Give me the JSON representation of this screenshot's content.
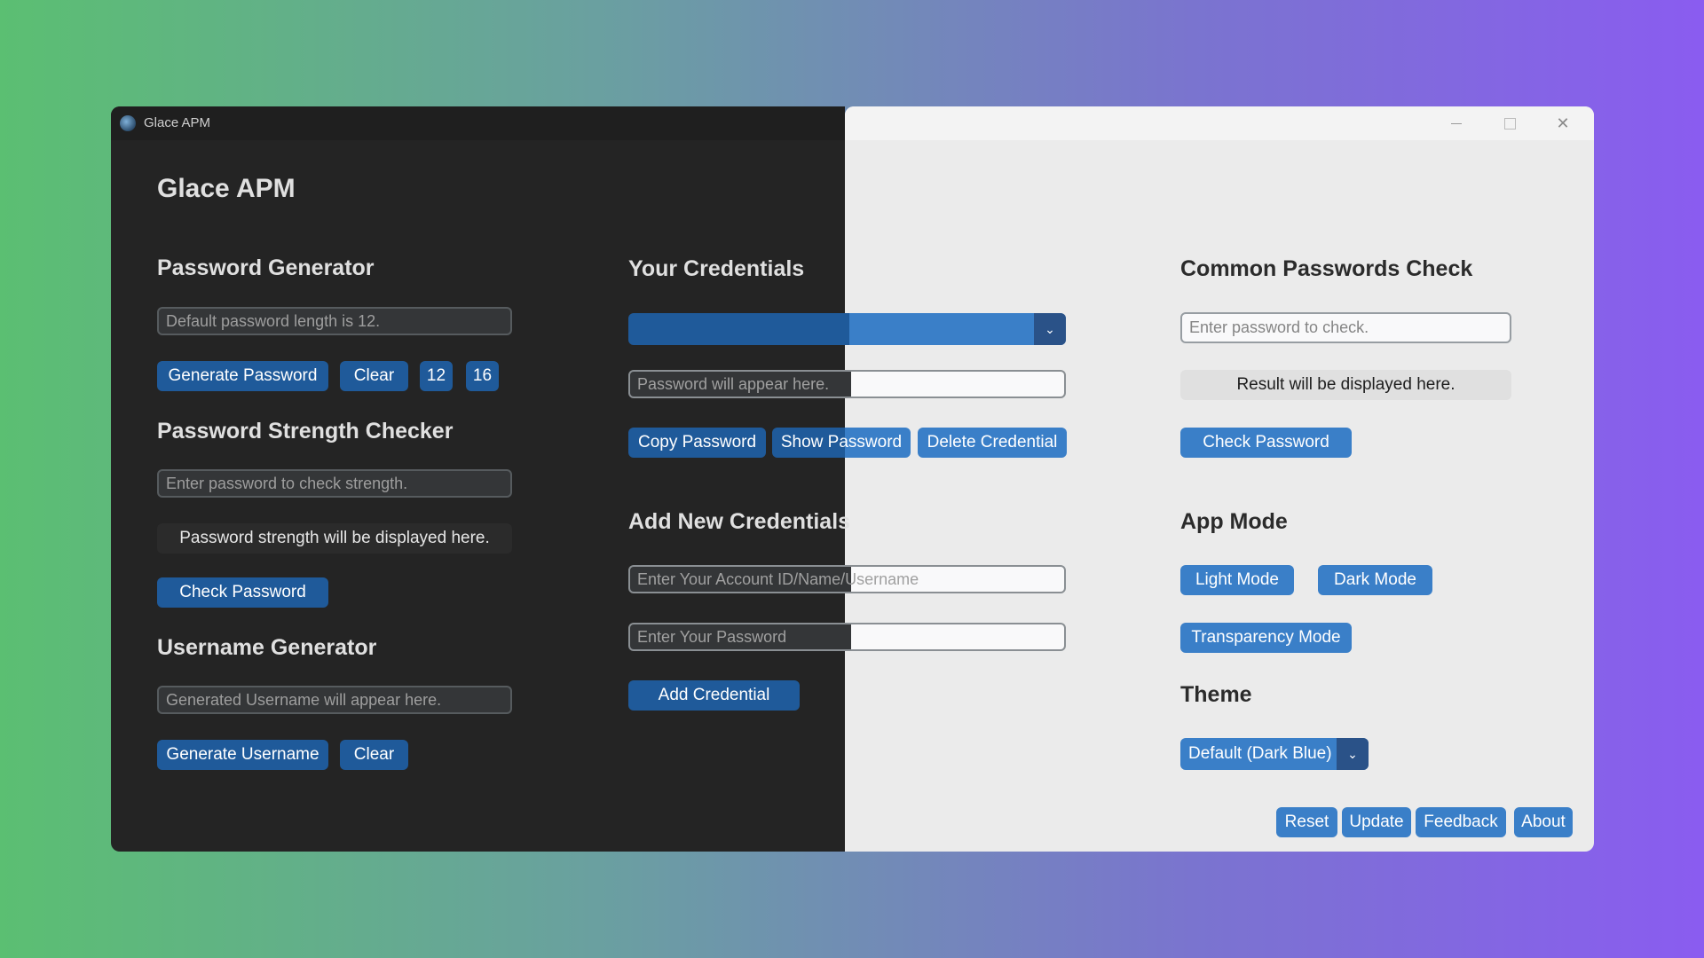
{
  "window": {
    "title": "Glace APM",
    "controls": {
      "minimize": "–",
      "maximize": "",
      "close": "✕"
    }
  },
  "app": {
    "heading": "Glace APM"
  },
  "password_generator": {
    "heading": "Password Generator",
    "placeholder": "Default password length is 12.",
    "generate_label": "Generate Password",
    "clear_label": "Clear",
    "len_12": "12",
    "len_16": "16"
  },
  "strength_checker": {
    "heading": "Password Strength Checker",
    "placeholder": "Enter password to check strength.",
    "result": "Password strength will be displayed here.",
    "check_label": "Check Password"
  },
  "username_generator": {
    "heading": "Username Generator",
    "placeholder": "Generated Username will appear here.",
    "generate_label": "Generate Username",
    "clear_label": "Clear"
  },
  "credentials": {
    "heading": "Your Credentials",
    "selected": "",
    "password_placeholder": "Password will appear here.",
    "copy_label": "Copy Password",
    "show_label": "Show Password",
    "delete_label": "Delete Credential"
  },
  "add_credentials": {
    "heading": "Add New Credentials",
    "account_placeholder": "Enter Your Account ID/Name/Username",
    "password_placeholder": "Enter Your Password",
    "add_label": "Add Credential"
  },
  "common_check": {
    "heading": "Common Passwords Check",
    "placeholder": "Enter password to check.",
    "result": "Result will be displayed here.",
    "check_label": "Check Password"
  },
  "app_mode": {
    "heading": "App Mode",
    "light_label": "Light Mode",
    "dark_label": "Dark Mode",
    "transparency_label": "Transparency Mode"
  },
  "theme": {
    "heading": "Theme",
    "selected": "Default (Dark Blue)"
  },
  "footer": {
    "reset": "Reset",
    "update": "Update",
    "feedback": "Feedback",
    "about": "About"
  },
  "icons": {
    "app": "app-logo-icon",
    "dropdown": "chevron-down-icon"
  },
  "colors": {
    "dark_bg": "#242424",
    "light_bg": "#ebebeb",
    "dark_button": "#1f5a9a",
    "light_button": "#3a7fc8"
  }
}
